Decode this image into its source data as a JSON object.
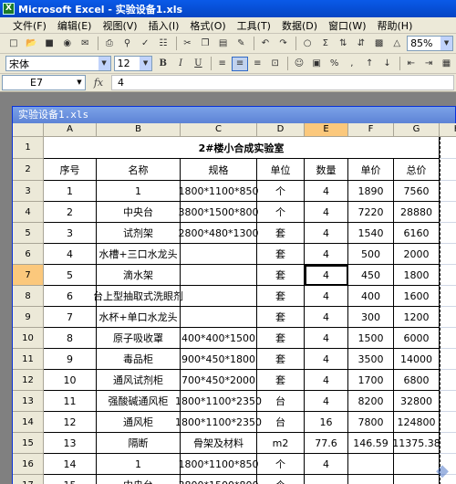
{
  "app": {
    "title": "Microsoft Excel - 实验设备1.xls",
    "icon_text": "X"
  },
  "menu": [
    "文件(F)",
    "编辑(E)",
    "视图(V)",
    "插入(I)",
    "格式(O)",
    "工具(T)",
    "数据(D)",
    "窗口(W)",
    "帮助(H)"
  ],
  "toolbar": {
    "zoom": "85%",
    "font_name": "宋体",
    "font_size": "12",
    "bold": "B",
    "italic": "I",
    "underline": "U",
    "percent": "%",
    "comma": ",",
    "sigma": "Σ"
  },
  "formula_bar": {
    "cell_ref": "E7",
    "fx": "fx",
    "value": "4"
  },
  "document": {
    "title": "实验设备1.xls"
  },
  "sheet": {
    "columns": [
      "A",
      "B",
      "C",
      "D",
      "E",
      "F",
      "G",
      "H"
    ],
    "selected_col": "E",
    "selected_row": 7,
    "title_row": "2#楼小合成实验室",
    "headers": [
      "序号",
      "名称",
      "规格",
      "单位",
      "数量",
      "单价",
      "总价"
    ],
    "rows": [
      {
        "row": 3,
        "cells": [
          "1",
          "1",
          "1800*1100*850",
          "个",
          "4",
          "1890",
          "7560"
        ]
      },
      {
        "row": 4,
        "cells": [
          "2",
          "中央台",
          "3800*1500*800",
          "个",
          "4",
          "7220",
          "28880"
        ]
      },
      {
        "row": 5,
        "cells": [
          "3",
          "试剂架",
          "2800*480*1300",
          "套",
          "4",
          "1540",
          "6160"
        ]
      },
      {
        "row": 6,
        "cells": [
          "4",
          "水槽+三口水龙头",
          "",
          "套",
          "4",
          "500",
          "2000"
        ]
      },
      {
        "row": 7,
        "cells": [
          "5",
          "滴水架",
          "",
          "套",
          "4",
          "450",
          "1800"
        ]
      },
      {
        "row": 8,
        "cells": [
          "6",
          "台上型抽取式洗眼剂",
          "",
          "套",
          "4",
          "400",
          "1600"
        ]
      },
      {
        "row": 9,
        "cells": [
          "7",
          "水杯+单口水龙头",
          "",
          "套",
          "4",
          "300",
          "1200"
        ]
      },
      {
        "row": 10,
        "cells": [
          "8",
          "原子吸收罩",
          "400*400*1500",
          "套",
          "4",
          "1500",
          "6000"
        ]
      },
      {
        "row": 11,
        "cells": [
          "9",
          "毒品柜",
          "900*450*1800",
          "套",
          "4",
          "3500",
          "14000"
        ]
      },
      {
        "row": 12,
        "cells": [
          "10",
          "通风试剂柜",
          "700*450*2000",
          "套",
          "4",
          "1700",
          "6800"
        ]
      },
      {
        "row": 13,
        "cells": [
          "11",
          "强酸碱通风柜",
          "1800*1100*2350",
          "台",
          "4",
          "8200",
          "32800"
        ]
      },
      {
        "row": 14,
        "cells": [
          "12",
          "通风柜",
          "1800*1100*2350",
          "台",
          "16",
          "7800",
          "124800"
        ]
      },
      {
        "row": 15,
        "cells": [
          "13",
          "隔断",
          "骨架及材料",
          "m2",
          "77.6",
          "146.59",
          "11375.38"
        ]
      },
      {
        "row": 16,
        "cells": [
          "14",
          "1",
          "1800*1100*850",
          "个",
          "4",
          "",
          ""
        ]
      },
      {
        "row": 17,
        "cells": [
          "15",
          "中央台",
          "3800*1500*800",
          "个",
          "",
          "",
          ""
        ]
      }
    ]
  }
}
